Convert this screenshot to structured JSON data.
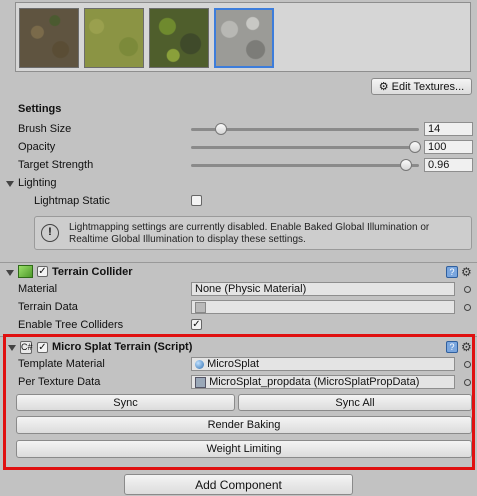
{
  "textures": [
    "dirt",
    "grass",
    "moss",
    "rock"
  ],
  "edit_textures_label": "Edit Textures...",
  "settings": {
    "header": "Settings",
    "brush_size": {
      "label": "Brush Size",
      "value": "14",
      "fraction": 0.11
    },
    "opacity": {
      "label": "Opacity",
      "value": "100",
      "fraction": 1.0
    },
    "target_strength": {
      "label": "Target Strength",
      "value": "0.96",
      "fraction": 0.96
    }
  },
  "lighting": {
    "header": "Lighting",
    "lightmap_static_label": "Lightmap Static",
    "lightmap_static_checked": false,
    "info_line1": "Lightmapping settings are currently disabled. Enable Baked Global Illumination or",
    "info_line2": "Realtime Global Illumination to display these settings."
  },
  "terrain_collider": {
    "title": "Terrain Collider",
    "enabled": true,
    "material_label": "Material",
    "material_value": "None (Physic Material)",
    "terrain_data_label": "Terrain Data",
    "terrain_data_value": "",
    "enable_tree_colliders_label": "Enable Tree Colliders",
    "enable_tree_colliders_checked": true
  },
  "micro_splat": {
    "title": "Micro Splat Terrain (Script)",
    "enabled": true,
    "template_material_label": "Template Material",
    "template_material_value": "MicroSplat",
    "per_texture_data_label": "Per Texture Data",
    "per_texture_data_value": "MicroSplat_propdata (MicroSplatPropData)",
    "sync_label": "Sync",
    "sync_all_label": "Sync All",
    "render_baking_label": "Render Baking",
    "weight_limiting_label": "Weight Limiting"
  },
  "add_component_label": "Add Component",
  "colors": {
    "highlight": "#e01010",
    "background": "#c2c2c2"
  }
}
